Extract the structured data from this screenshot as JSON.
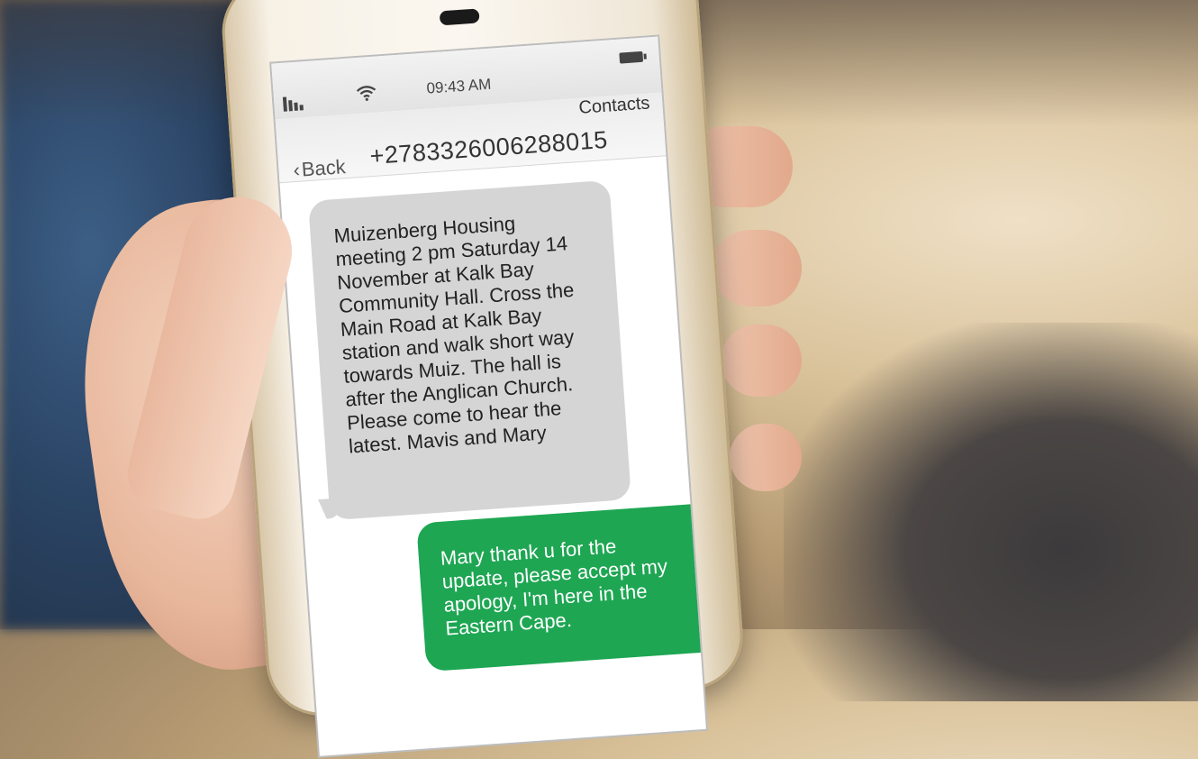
{
  "status_bar": {
    "time": "09:43 AM",
    "icons": [
      "signal-icon",
      "wifi-icon",
      "battery-icon"
    ]
  },
  "nav": {
    "back_label": "Back",
    "back_icon": "chevron-left-icon",
    "phone_number": "+2783326006288015",
    "contacts_label": "Contacts"
  },
  "messages": [
    {
      "direction": "incoming",
      "text": "Muizenberg Housing\nmeeting 2 pm Saturday 14\nNovember at Kalk Bay\nCommunity Hall. Cross the\nMain Road at Kalk Bay\nstation and walk short way\ntowards Muiz. The hall is\nafter the Anglican Church.\nPlease come to hear the\nlatest. Mavis and Mary"
    },
    {
      "direction": "outgoing",
      "text": "Mary thank u for the\nupdate, please accept my\napology, I'm here in the\nEastern Cape."
    }
  ],
  "colors": {
    "incoming_bubble": "#d5d5d5",
    "outgoing_bubble": "#1ea653"
  }
}
